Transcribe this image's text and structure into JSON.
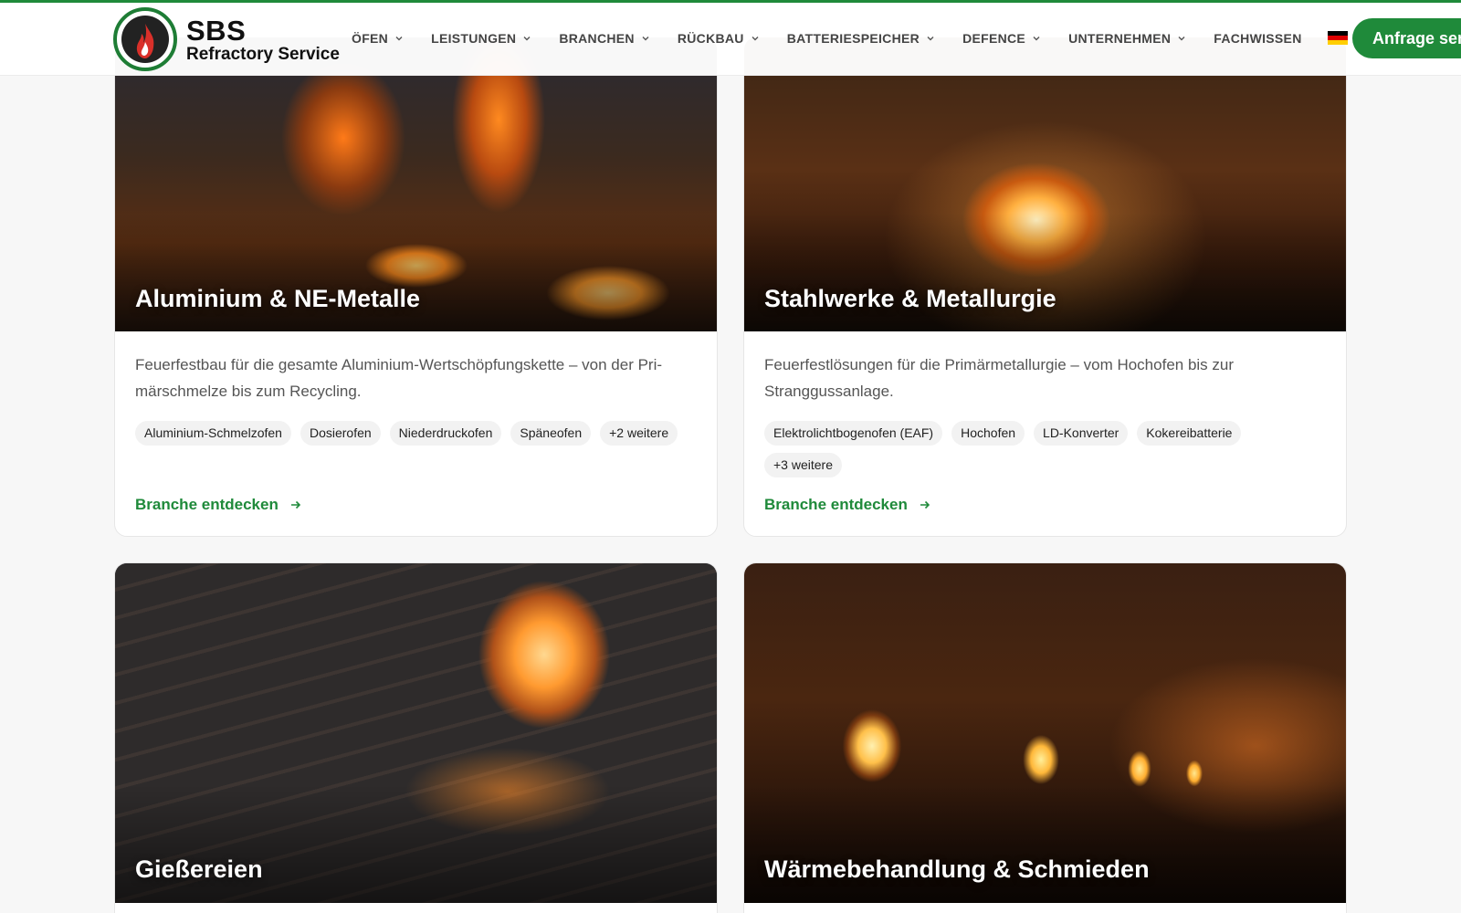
{
  "brand": {
    "name": "SBS",
    "tagline": "Refractory Service",
    "accent": "#1f8a3a"
  },
  "nav": {
    "items": [
      {
        "label": "ÖFEN",
        "has_dropdown": true
      },
      {
        "label": "LEISTUNGEN",
        "has_dropdown": true
      },
      {
        "label": "BRANCHEN",
        "has_dropdown": true
      },
      {
        "label": "RÜCKBAU",
        "has_dropdown": true
      },
      {
        "label": "BATTERIESPEICHER",
        "has_dropdown": true
      },
      {
        "label": "DEFENCE",
        "has_dropdown": true
      },
      {
        "label": "UNTERNEHMEN",
        "has_dropdown": true
      },
      {
        "label": "FACHWISSEN",
        "has_dropdown": false
      }
    ],
    "language": "DE",
    "cta_label": "Anfrage sen"
  },
  "cards": [
    {
      "title": "Aluminium & NE-Metalle",
      "description": "Feuerfestbau für die gesamte Aluminium-Wertschöpfungskette – von der Pri-märschmelze bis zum Recycling.",
      "tags": [
        "Aluminium-Schmelzofen",
        "Dosierofen",
        "Niederdruckofen",
        "Späneofen",
        "+2 weitere"
      ],
      "link": "Branche entdecken"
    },
    {
      "title": "Stahlwerke & Metallurgie",
      "description": "Feuerfestlösungen für die Primärmetallurgie – vom Hochofen bis zur Stranggussanlage.",
      "tags": [
        "Elektrolichtbogenofen (EAF)",
        "Hochofen",
        "LD-Konverter",
        "Kokereibatterie",
        "+3 weitere"
      ],
      "link": "Branche entdecken"
    },
    {
      "title": "Gießereien"
    },
    {
      "title": "Wärmebehandlung & Schmieden"
    }
  ]
}
